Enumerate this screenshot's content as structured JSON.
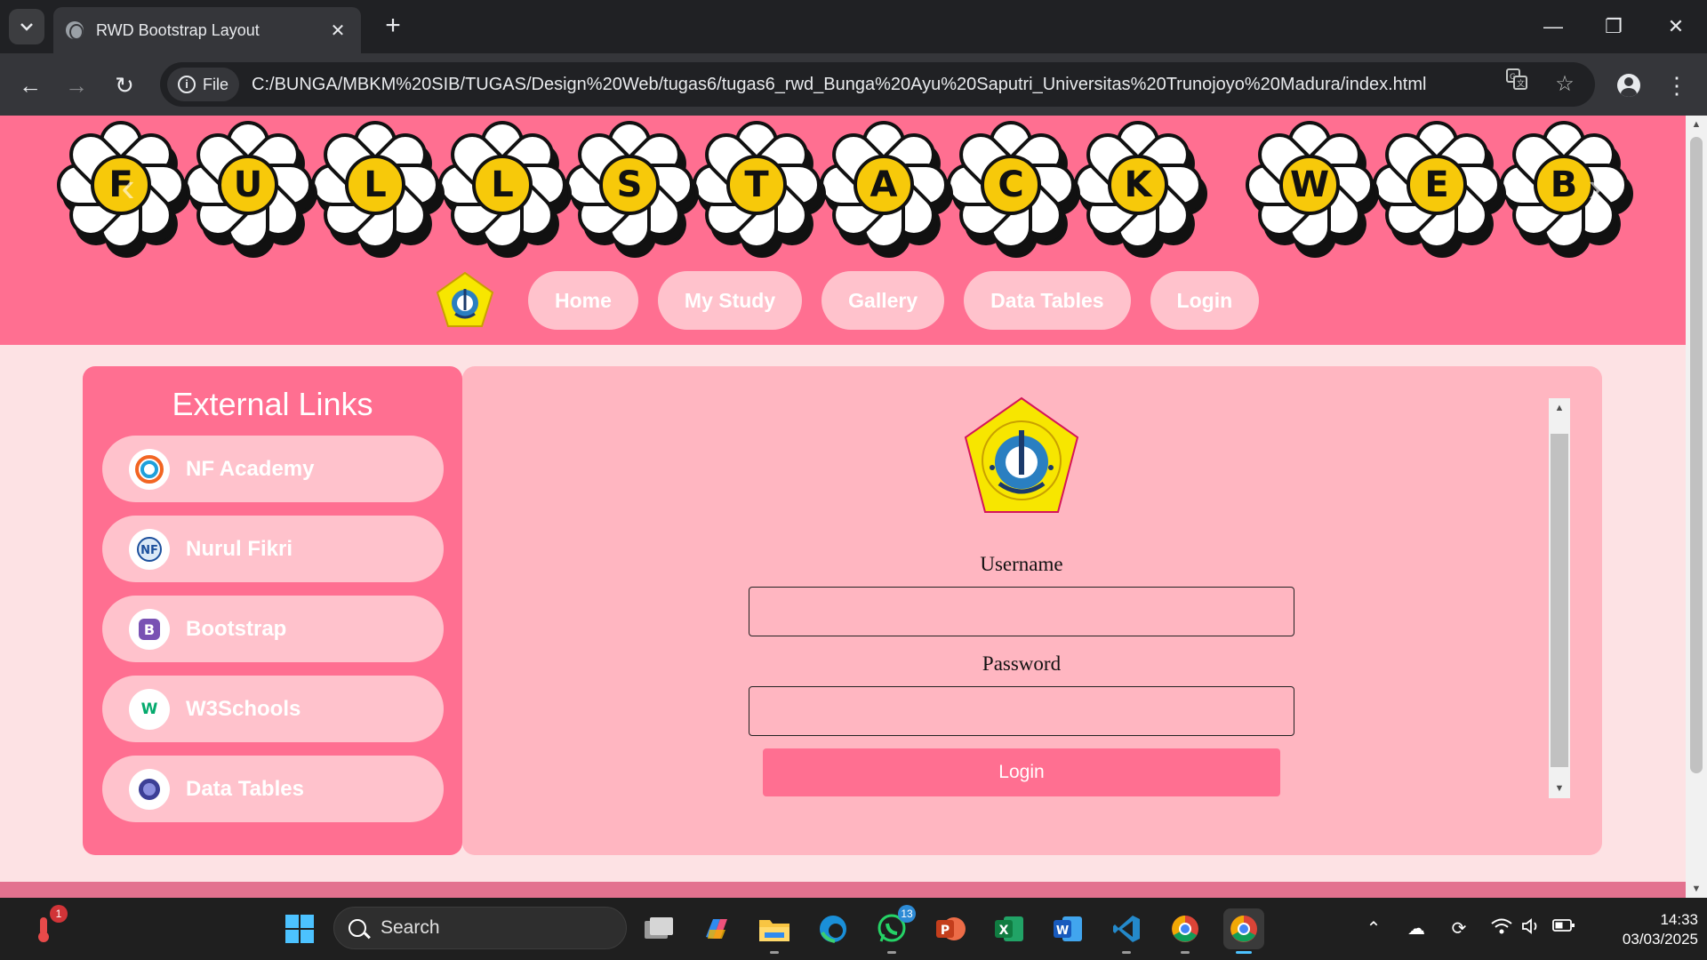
{
  "browser": {
    "tab_title": "RWD Bootstrap Layout",
    "tab_close": "✕",
    "new_tab": "+",
    "window": {
      "minimize": "—",
      "restore": "❐",
      "close": "✕"
    },
    "back": "←",
    "forward": "→",
    "reload": "↻",
    "site_chip": "File",
    "url": "C:/BUNGA/MBKM%20SIB/TUGAS/Design%20Web/tugas6/tugas6_rwd_Bunga%20Ayu%20Saputri_Universitas%20Trunojoyo%20Madura/index.html",
    "menu": "⋮"
  },
  "banner": {
    "letters": [
      "F",
      "U",
      "L",
      "L",
      "S",
      "T",
      "A",
      "C",
      "K",
      "W",
      "E",
      "B"
    ],
    "prev": "‹",
    "next": "›"
  },
  "nav": {
    "items": [
      "Home",
      "My Study",
      "Gallery",
      "Data Tables",
      "Login"
    ]
  },
  "sidebar": {
    "title": "External Links",
    "links": [
      {
        "label": "NF Academy",
        "icon": "nf-academy-icon"
      },
      {
        "label": "Nurul Fikri",
        "icon": "nurul-fikri-icon"
      },
      {
        "label": "Bootstrap",
        "icon": "bootstrap-icon"
      },
      {
        "label": "W3Schools",
        "icon": "w3schools-icon"
      },
      {
        "label": "Data Tables",
        "icon": "datatables-icon"
      }
    ]
  },
  "login_form": {
    "username_label": "Username",
    "username_value": "",
    "password_label": "Password",
    "password_value": "",
    "submit_label": "Login"
  },
  "taskbar": {
    "search_label": "Search",
    "notification_count": "1",
    "whatsapp_badge": "13",
    "clock_time": "14:33",
    "clock_date": "03/03/2025"
  },
  "colors": {
    "header_pink": "#ff6f91",
    "pill_pink": "#ffc2cc",
    "card_pink": "#ffb6c1",
    "page_bg": "#fde2e4",
    "flower_center": "#f7c90a"
  }
}
